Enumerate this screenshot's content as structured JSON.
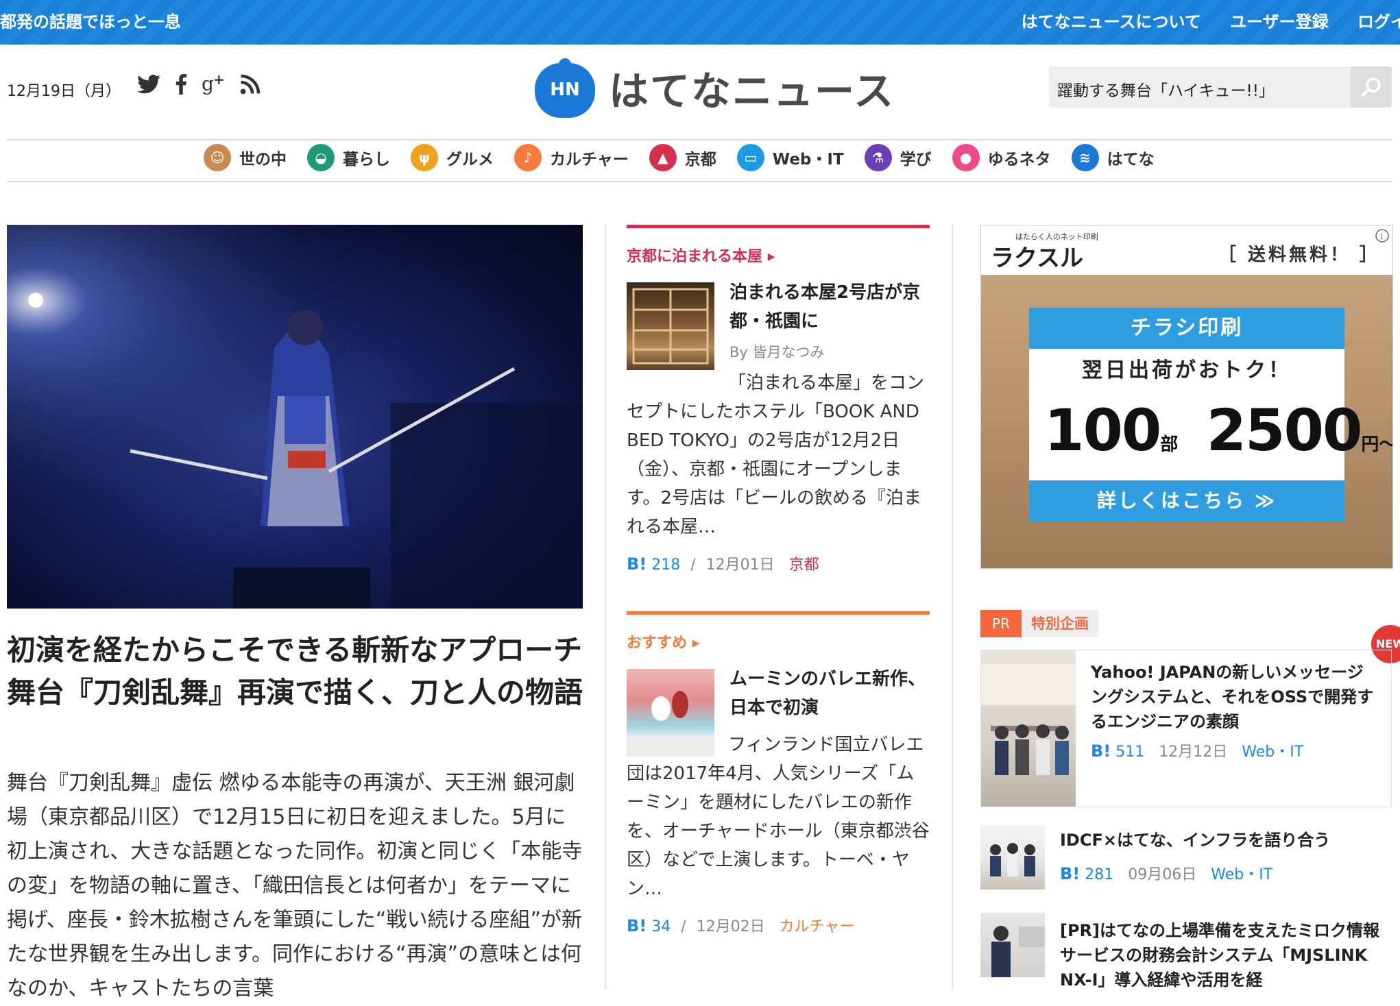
{
  "topbar": {
    "tagline": "都発の話題でほっと一息",
    "links": [
      "はてなニュースについて",
      "ユーザー登録",
      "ログイ"
    ]
  },
  "header": {
    "date": "12月19日（月）",
    "social_icons": [
      "twitter-icon",
      "facebook-icon",
      "google-plus-icon",
      "rss-icon"
    ],
    "logo_badge": "HN",
    "logo_text": "はてなニュース",
    "search_value": "躍動する舞台「ハイキュー!!」"
  },
  "nav": [
    {
      "label": "世の中",
      "icon": "people-icon",
      "color": "#c98a4f"
    },
    {
      "label": "暮らし",
      "icon": "pot-icon",
      "color": "#1d9a7a"
    },
    {
      "label": "グルメ",
      "icon": "cutlery-icon",
      "color": "#f0a21c"
    },
    {
      "label": "カルチャー",
      "icon": "microphone-icon",
      "color": "#f57c3a"
    },
    {
      "label": "京都",
      "icon": "pagoda-icon",
      "color": "#d32f4f"
    },
    {
      "label": "Web・IT",
      "icon": "monitor-icon",
      "color": "#1e9be0"
    },
    {
      "label": "学び",
      "icon": "flask-icon",
      "color": "#6a3fb5"
    },
    {
      "label": "ゆるネタ",
      "icon": "cat-icon",
      "color": "#ee4a8a"
    },
    {
      "label": "はてな",
      "icon": "hatena-icon",
      "color": "#1a78d6"
    }
  ],
  "lead": {
    "title": "初演を経たからこそできる斬新なアプローチ　舞台『刀剣乱舞』再演で描く、刀と人の物語",
    "body": "舞台『刀剣乱舞』虚伝 燃ゆる本能寺の再演が、天王洲 銀河劇場（東京都品川区）で12月15日に初日を迎えました。5月に初上演され、大きな話題となった同作。初演と同じく「本能寺の変」を物語の軸に置き、「織田信長とは何者か」をテーマに掲げ、座長・鈴木拡樹さんを筆頭にした“戦い続ける座組”が新たな世界観を生み出します。同作における“再演”の意味とは何なのか、キャストたちの言葉"
  },
  "middle": [
    {
      "section": "京都に泊まれる本屋 ▸",
      "section_color": "#d32f4f",
      "title": "泊まれる本屋2号店が京都・祇園に",
      "byline": "By 皆月なつみ",
      "body": "「泊まれる本屋」をコンセプトにしたホステル「BOOK AND BED TOKYO」の2号店が12月2日（金）、京都・祇園にオープンします。2号店は「ビールの飲める『泊まれる本屋…",
      "bookmark_label": "B!",
      "bookmarks": "218",
      "separator": "/",
      "date": "12月01日",
      "category": "京都",
      "category_color": "#d32f4f"
    },
    {
      "section": "おすすめ ▸",
      "section_color": "#f47a3c",
      "title": "ムーミンのバレエ新作、日本で初演",
      "byline": "",
      "body": "フィンランド国立バレエ団は2017年4月、人気シリーズ「ムーミン」を題材にしたバレエの新作を、オーチャードホール（東京都渋谷区）などで上演します。トーベ・ヤン…",
      "bookmark_label": "B!",
      "bookmarks": "34",
      "separator": "/",
      "date": "12月02日",
      "category": "カルチャー",
      "category_color": "#f47a3c"
    }
  ],
  "ad": {
    "brand_sub": "はたらく人のネット印刷",
    "brand": "ラクスル",
    "free_shipping": "［ 送料無料！ ］",
    "headline": "チラシ印刷",
    "sub": "翌日出荷がおトク！",
    "qty": "100",
    "qty_unit": "部",
    "price": "2500",
    "price_unit": "円～［税抜］",
    "cta": "詳しくはこちら ≫"
  },
  "pr": {
    "tag": "PR",
    "label": "特別企画",
    "new_badge": "NEW",
    "featured": {
      "title": "Yahoo! JAPANの新しいメッセージングシステムと、それをOSSで開発するエンジニアの素顔",
      "bookmark_label": "B!",
      "bookmarks": "511",
      "date": "12月12日",
      "category": "Web・IT"
    },
    "items": [
      {
        "title": "IDCF×はてな、インフラを語り合う",
        "bookmark_label": "B!",
        "bookmarks": "281",
        "date": "09月06日",
        "category": "Web・IT"
      },
      {
        "title": "[PR]はてなの上場準備を支えたミロク情報サービスの財務会計システム「MJSLINK NX-I」導入経緯や活用を経",
        "bookmark_label": "",
        "bookmarks": "",
        "date": "",
        "category": ""
      }
    ]
  }
}
